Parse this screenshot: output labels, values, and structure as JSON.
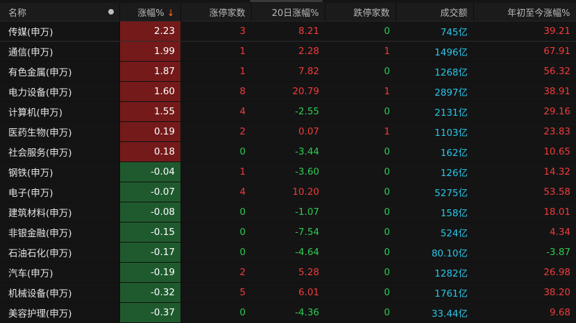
{
  "headers": {
    "name": "名称",
    "pct": "涨幅%",
    "sort_arrow": "↓",
    "limit_up": "涨停家数",
    "d20": "20日涨幅%",
    "limit_down": "跌停家数",
    "volume": "成交额",
    "ytd": "年初至今涨幅%"
  },
  "colors": {
    "up_bg": "#741a1a",
    "down_bg": "#1f5a2e",
    "red": "#f23b3b",
    "green": "#2ecc52",
    "cyan": "#29c6e8"
  },
  "rows": [
    {
      "name": "传媒(申万)",
      "pct": "2.23",
      "limit_up": "3",
      "d20": "8.21",
      "limit_down": "0",
      "volume": "745亿",
      "ytd": "39.21"
    },
    {
      "name": "通信(申万)",
      "pct": "1.99",
      "limit_up": "1",
      "d20": "2.28",
      "limit_down": "1",
      "volume": "1496亿",
      "ytd": "67.91"
    },
    {
      "name": "有色金属(申万)",
      "pct": "1.87",
      "limit_up": "1",
      "d20": "7.82",
      "limit_down": "0",
      "volume": "1268亿",
      "ytd": "56.32"
    },
    {
      "name": "电力设备(申万)",
      "pct": "1.60",
      "limit_up": "8",
      "d20": "20.79",
      "limit_down": "1",
      "volume": "2897亿",
      "ytd": "38.91"
    },
    {
      "name": "计算机(申万)",
      "pct": "1.55",
      "limit_up": "4",
      "d20": "-2.55",
      "limit_down": "0",
      "volume": "2131亿",
      "ytd": "29.16"
    },
    {
      "name": "医药生物(申万)",
      "pct": "0.19",
      "limit_up": "2",
      "d20": "0.07",
      "limit_down": "1",
      "volume": "1103亿",
      "ytd": "23.83"
    },
    {
      "name": "社会服务(申万)",
      "pct": "0.18",
      "limit_up": "0",
      "d20": "-3.44",
      "limit_down": "0",
      "volume": "162亿",
      "ytd": "10.65"
    },
    {
      "name": "钢铁(申万)",
      "pct": "-0.04",
      "limit_up": "1",
      "d20": "-3.60",
      "limit_down": "0",
      "volume": "126亿",
      "ytd": "14.32"
    },
    {
      "name": "电子(申万)",
      "pct": "-0.07",
      "limit_up": "4",
      "d20": "10.20",
      "limit_down": "0",
      "volume": "5275亿",
      "ytd": "53.58"
    },
    {
      "name": "建筑材料(申万)",
      "pct": "-0.08",
      "limit_up": "0",
      "d20": "-1.07",
      "limit_down": "0",
      "volume": "158亿",
      "ytd": "18.01"
    },
    {
      "name": "非银金融(申万)",
      "pct": "-0.15",
      "limit_up": "0",
      "d20": "-7.54",
      "limit_down": "0",
      "volume": "524亿",
      "ytd": "4.34"
    },
    {
      "name": "石油石化(申万)",
      "pct": "-0.17",
      "limit_up": "0",
      "d20": "-4.64",
      "limit_down": "0",
      "volume": "80.10亿",
      "ytd": "-3.87"
    },
    {
      "name": "汽车(申万)",
      "pct": "-0.19",
      "limit_up": "2",
      "d20": "5.28",
      "limit_down": "0",
      "volume": "1282亿",
      "ytd": "26.98"
    },
    {
      "name": "机械设备(申万)",
      "pct": "-0.32",
      "limit_up": "5",
      "d20": "6.01",
      "limit_down": "0",
      "volume": "1761亿",
      "ytd": "38.20"
    },
    {
      "name": "美容护理(申万)",
      "pct": "-0.37",
      "limit_up": "0",
      "d20": "-4.36",
      "limit_down": "0",
      "volume": "33.44亿",
      "ytd": "9.68"
    }
  ]
}
